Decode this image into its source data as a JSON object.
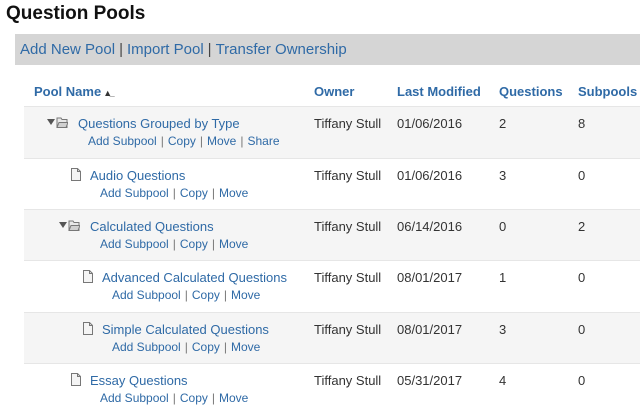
{
  "page": {
    "title": "Question Pools"
  },
  "toolbar": {
    "add_new_pool": "Add New Pool",
    "separator": "|",
    "import_pool": "Import Pool",
    "transfer_ownership": "Transfer Ownership"
  },
  "table": {
    "columns": {
      "name": "Pool Name",
      "owner": "Owner",
      "modified": "Last Modified",
      "questions": "Questions",
      "subpools": "Subpools"
    },
    "sort_icon": "sort-ascending-icon",
    "action_labels": {
      "add_subpool": "Add Subpool",
      "copy": "Copy",
      "move": "Move",
      "share": "Share",
      "sep": "|"
    },
    "rows": [
      {
        "name": "Questions Grouped by Type",
        "owner": "Tiffany Stull",
        "modified": "01/06/2016",
        "questions": "2",
        "subpools": "8",
        "icon": "open-folder-icon",
        "expanded": true,
        "share": true
      },
      {
        "name": "Audio Questions",
        "owner": "Tiffany Stull",
        "modified": "01/06/2016",
        "questions": "3",
        "subpools": "0",
        "icon": "document-icon",
        "expanded": false,
        "share": false
      },
      {
        "name": "Calculated Questions",
        "owner": "Tiffany Stull",
        "modified": "06/14/2016",
        "questions": "0",
        "subpools": "2",
        "icon": "open-folder-icon",
        "expanded": true,
        "share": false
      },
      {
        "name": "Advanced Calculated Questions",
        "owner": "Tiffany Stull",
        "modified": "08/01/2017",
        "questions": "1",
        "subpools": "0",
        "icon": "document-icon",
        "expanded": false,
        "share": false
      },
      {
        "name": "Simple Calculated Questions",
        "owner": "Tiffany Stull",
        "modified": "08/01/2017",
        "questions": "3",
        "subpools": "0",
        "icon": "document-icon",
        "expanded": false,
        "share": false
      },
      {
        "name": "Essay Questions",
        "owner": "Tiffany Stull",
        "modified": "05/31/2017",
        "questions": "4",
        "subpools": "0",
        "icon": "document-icon",
        "expanded": false,
        "share": false
      }
    ]
  }
}
